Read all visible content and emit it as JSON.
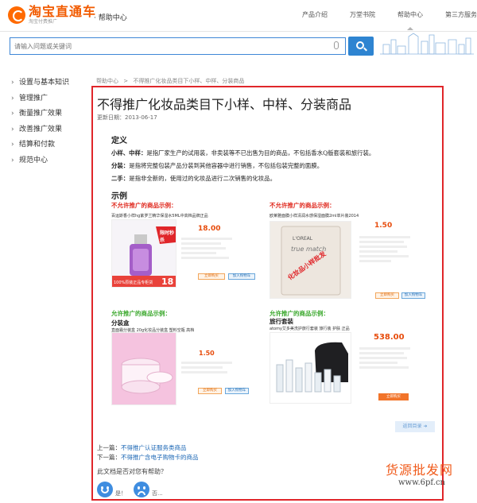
{
  "header": {
    "logo_title": "淘宝直通车",
    "logo_sub": "淘宝付费推广",
    "help_title": "· 帮助中心",
    "nav": [
      "产品介绍",
      "万堂书院",
      "帮助中心",
      "第三方服务"
    ]
  },
  "search": {
    "placeholder": "请输入问题或关键词"
  },
  "sidebar": {
    "items": [
      "设置与基本知识",
      "管理推广",
      "衡量推广效果",
      "改善推广效果",
      "结算和付款",
      "规范中心"
    ]
  },
  "breadcrumb": [
    "帮助中心",
    ">",
    "不得推广化妆品类目下小样、中样、分装商品"
  ],
  "article": {
    "title": "不得推广化妆品类目下小样、中样、分装商品",
    "update_date": "更新日期：2013-06-17",
    "definition_heading": "定义",
    "definitions": [
      {
        "term": "小样、中样：",
        "text": "是指厂家生产的试用装，非卖装等不已出售为目的商品，不包括香水Q版套装和旅行装。"
      },
      {
        "term": "分装：",
        "text": "是指将完整包装产品分装到其他容器中进行销售，不包括包装完整的面膜。"
      },
      {
        "term": "二手：",
        "text": "是指非全新的，使用过的化妆品进行二次销售的化妆品。"
      }
    ],
    "example_heading": "示例",
    "examples": [
      {
        "label": "不允许推广的商品示例：",
        "sub": "",
        "name": "百运斯香小样hg紫罗兰精华保湿水5ML中高档品牌正品",
        "price": "18.00",
        "badge_top": "限时秒杀",
        "badge_bottom": "100%原装正品专柜货",
        "badge_num": "18",
        "btn1": "立即购买",
        "btn2": "加入购物车"
      },
      {
        "label": "不允许推广的商品示例：",
        "sub": "",
        "name": "欧莱雅面膜小样清润水感保湿面膜2ml单片装2014",
        "price": "1.50",
        "stamp": "化妆品小样批发",
        "pack_brand": "L'OREAL",
        "pack_text": "true match",
        "btn1": "立即购买",
        "btn2": "加入购物车"
      },
      {
        "label": "允许推广的商品示例：",
        "sub": "分装盒",
        "name": "直面霜分装盒 20g化妆品分装盒 塑料空瓶 高档",
        "price": "1.50",
        "btn1": "立即购买",
        "btn2": "加入购物车"
      },
      {
        "label": "允许推广的商品示例：",
        "sub": "旅行套装",
        "name": "atomy艾多美洗护旅行套装 旅行装 护肤 正品",
        "price": "538.00",
        "btn1": "立即购买"
      }
    ],
    "back_button": "返回目录",
    "prev_label": "上一篇：",
    "prev_link": "不得推广认证服务类商品",
    "next_label": "下一篇：",
    "next_link": "不得推广含电子购物卡的商品",
    "helpful_question": "此文档是否对您有帮助？",
    "yes_label": "是！",
    "no_label": "否..."
  },
  "watermark": {
    "line1": "货源批发网",
    "line2": "www.6pf.cn"
  },
  "colors": {
    "accent_blue": "#2e84d1",
    "frame_red": "#e0262a",
    "brand_orange": "#f25b00"
  }
}
